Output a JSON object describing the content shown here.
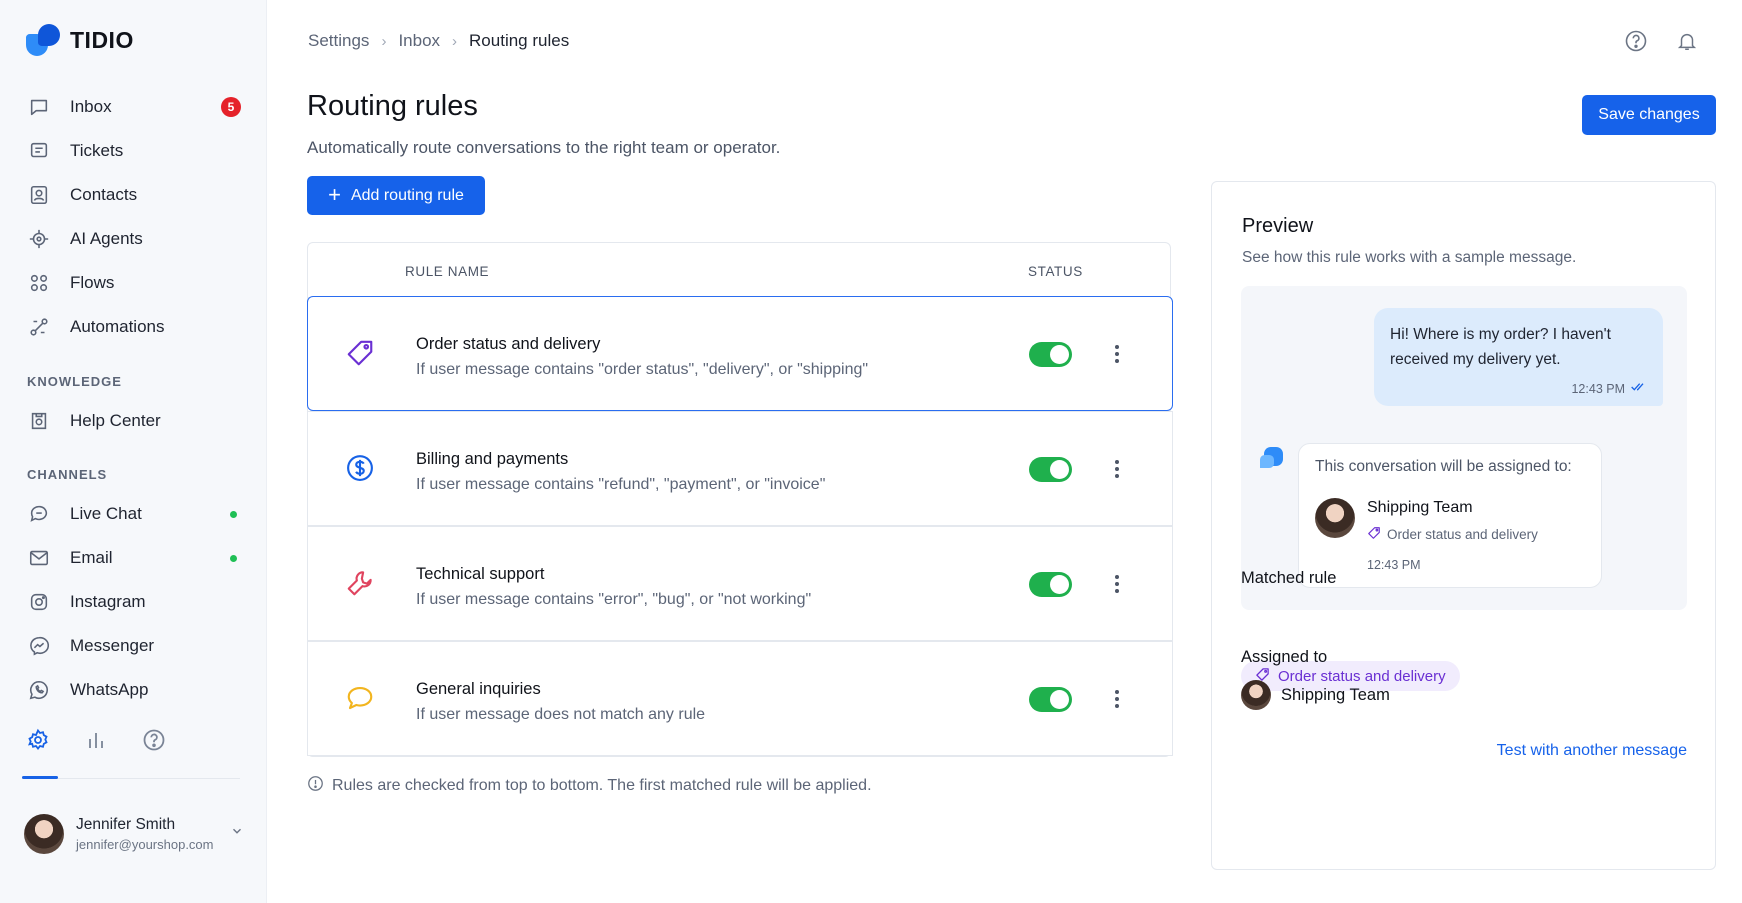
{
  "brand": {
    "name": "TIDIO"
  },
  "sidebar": {
    "main_items": [
      {
        "label": "Inbox",
        "icon": "chat-bubble-icon",
        "badge": "5"
      },
      {
        "label": "Tickets",
        "icon": "ticket-icon"
      },
      {
        "label": "Contacts",
        "icon": "contact-card-icon"
      },
      {
        "label": "AI Agents",
        "icon": "ai-agent-icon"
      },
      {
        "label": "Flows",
        "icon": "flows-icon"
      },
      {
        "label": "Automations",
        "icon": "automations-icon"
      }
    ],
    "knowledge_label": "KNOWLEDGE",
    "knowledge_items": [
      {
        "label": "Help Center",
        "icon": "help-center-icon"
      }
    ],
    "channels_label": "CHANNELS",
    "channel_items": [
      {
        "label": "Live Chat",
        "icon": "live-chat-icon",
        "online": true
      },
      {
        "label": "Email",
        "icon": "email-icon",
        "online": true
      },
      {
        "label": "Instagram",
        "icon": "instagram-icon"
      },
      {
        "label": "Messenger",
        "icon": "messenger-icon"
      },
      {
        "label": "WhatsApp",
        "icon": "whatsapp-icon"
      }
    ],
    "bottom_icons": [
      "gear-icon",
      "analytics-icon",
      "help-icon"
    ],
    "user": {
      "name": "Jennifer Smith",
      "email": "jennifer@yourshop.com"
    }
  },
  "header": {
    "breadcrumbs": [
      "Settings",
      "Inbox",
      "Routing rules"
    ],
    "icons": [
      "help-icon",
      "bell-icon"
    ]
  },
  "page": {
    "title": "Routing rules",
    "subtitle": "Automatically route conversations to the right team or operator.",
    "save_label": "Save changes",
    "add_label": "Add routing rule"
  },
  "table": {
    "col_name": "RULE NAME",
    "col_status": "STATUS",
    "rules": [
      {
        "title": "Order status and delivery",
        "desc": "If user message contains \"order status\", \"delivery\", or \"shipping\"",
        "icon": "tag-icon",
        "enabled": true,
        "selected": true
      },
      {
        "title": "Billing and payments",
        "desc": "If user message contains \"refund\", \"payment\", or \"invoice\"",
        "icon": "dollar-icon",
        "enabled": true
      },
      {
        "title": "Technical support",
        "desc": "If user message contains \"error\", \"bug\", or \"not working\"",
        "icon": "wrench-icon",
        "enabled": true
      },
      {
        "title": "General inquiries",
        "desc": "If user message does not match any rule",
        "icon": "speech-bubble-icon",
        "enabled": true
      }
    ],
    "note": "Rules are checked from top to bottom. The first matched rule will be applied."
  },
  "preview": {
    "title": "Preview",
    "subtitle": "See how this rule works with a sample message.",
    "user_message": "Hi! Where is my order? I haven't received my delivery yet.",
    "user_time": "12:43 PM",
    "bot_intro": "This conversation will be assigned to:",
    "bot_team": "Shipping Team",
    "bot_rule": "Order status and delivery",
    "bot_time": "12:43 PM",
    "matched_label": "Matched rule",
    "matched_rule": "Order status and delivery",
    "assigned_label": "Assigned to",
    "assigned_team": "Shipping Team",
    "test_link": "Test with another message"
  },
  "colors": {
    "accent": "#1662ea",
    "toggle_on": "#1fb04d",
    "badge": "#e5222a",
    "online": "#1fbf55",
    "chip_bg": "#f1ecfd",
    "chip_text": "#6a2fd3"
  }
}
